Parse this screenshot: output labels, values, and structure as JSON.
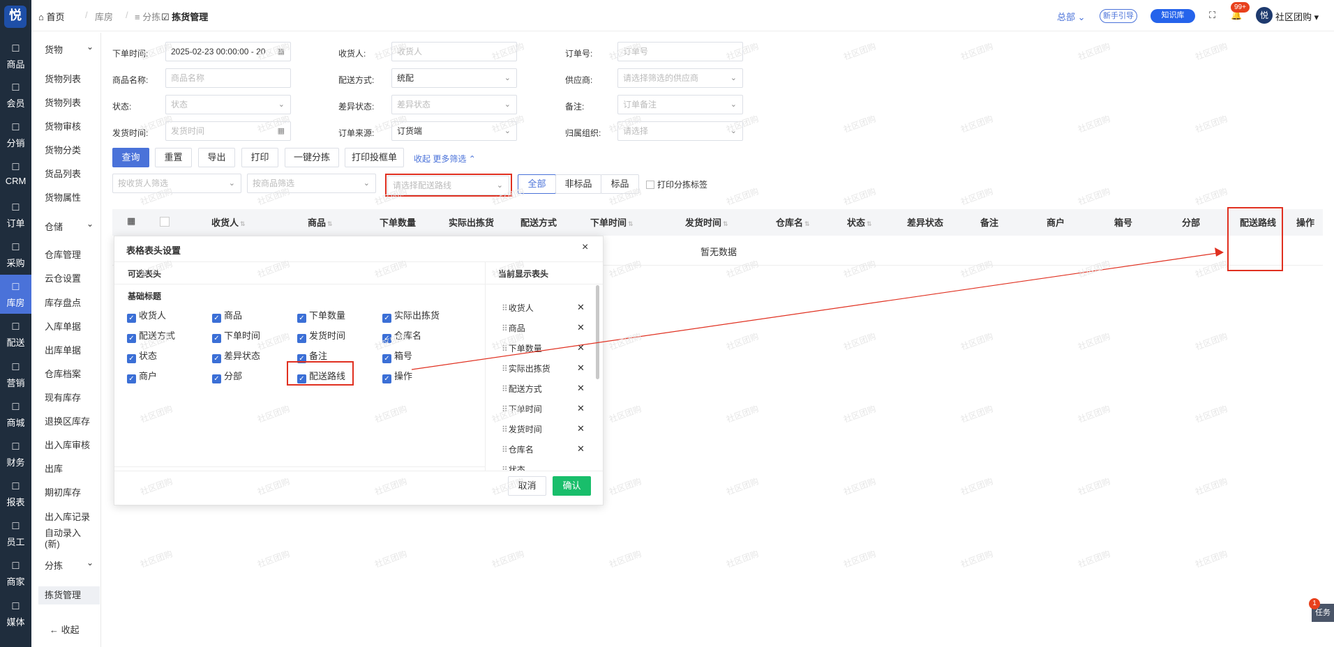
{
  "rail": {
    "logo": "悦",
    "items": [
      {
        "icon": "bag-icon",
        "label": "商品"
      },
      {
        "icon": "user-icon",
        "label": "会员"
      },
      {
        "icon": "share-icon",
        "label": "分销"
      },
      {
        "icon": "crm-icon",
        "label": "CRM"
      },
      {
        "icon": "order-icon",
        "label": "订单"
      },
      {
        "icon": "purchase-icon",
        "label": "采购"
      },
      {
        "icon": "warehouse-icon",
        "label": "库房"
      },
      {
        "icon": "delivery-icon",
        "label": "配送"
      },
      {
        "icon": "gift-icon",
        "label": "营销"
      },
      {
        "icon": "shop-icon",
        "label": "商城"
      },
      {
        "icon": "yen-icon",
        "label": "财务"
      },
      {
        "icon": "chart-icon",
        "label": "报表"
      },
      {
        "icon": "staff-icon",
        "label": "员工"
      },
      {
        "icon": "merchant-icon",
        "label": "商家"
      },
      {
        "icon": "play-icon",
        "label": "媒体"
      }
    ]
  },
  "subnav": {
    "groups": [
      {
        "title": "货物",
        "items": [
          "货物列表",
          "货物列表",
          "货物审核",
          "货物分类",
          "货品列表",
          "货物属性"
        ]
      },
      {
        "title": "仓储",
        "items": [
          "仓库管理",
          "云仓设置",
          "库存盘点",
          "入库单据",
          "出库单据",
          "仓库档案",
          "现有库存",
          "退换区库存",
          "出入库审核",
          "出库",
          "期初库存",
          "出入库记录",
          "自动录入(新)"
        ]
      },
      {
        "title": "分拣",
        "items": [
          "拣货管理"
        ]
      }
    ],
    "collapse": "收起"
  },
  "topbar": {
    "home": "首页",
    "crumbs": [
      "库房",
      "分拣"
    ],
    "current": "拣货管理",
    "branch": "总部",
    "guide": "新手引导",
    "knowledge": "知识库",
    "badge": "99+",
    "org": "社区团购",
    "task_badge": "1",
    "task": "任务"
  },
  "filters": {
    "order_time_label": "下单时间:",
    "order_time_value": "2025-02-23 00:00:00 - 20",
    "receiver_label": "收货人:",
    "receiver_ph": "收货人",
    "order_no_label": "订单号:",
    "order_no_ph": "订单号",
    "goods_name_label": "商品名称:",
    "goods_name_ph": "商品名称",
    "delivery_label": "配送方式:",
    "delivery_value": "统配",
    "supplier_label": "供应商:",
    "supplier_ph": "请选择筛选的供应商",
    "status_label": "状态:",
    "status_ph": "状态",
    "diff_label": "差异状态:",
    "diff_ph": "差异状态",
    "remark_label": "备注:",
    "remark_ph": "订单备注",
    "ship_label": "发货时间:",
    "ship_ph": "发货时间",
    "source_label": "订单来源:",
    "source_value": "订货端",
    "org_label": "归属组织:",
    "org_ph": "请选择"
  },
  "actions": {
    "query": "查询",
    "reset": "重置",
    "export": "导出",
    "print": "打印",
    "one_click": "一键分拣",
    "print_box": "打印投框单",
    "collapse": "收起",
    "more": "更多筛选"
  },
  "filters2": {
    "by_receiver": "按收货人筛选",
    "by_goods": "按商品筛选",
    "route": "请选择配送路线",
    "seg": [
      "全部",
      "非标品",
      "标品"
    ],
    "print_label": "打印分拣标签"
  },
  "table": {
    "headers": [
      "收货人",
      "商品",
      "下单数量",
      "实际出拣货",
      "配送方式",
      "下单时间",
      "发货时间",
      "仓库名",
      "状态",
      "差异状态",
      "备注",
      "商户",
      "箱号",
      "分部",
      "配送路线",
      "操作"
    ],
    "empty": "暂无数据"
  },
  "modal": {
    "title": "表格表头设置",
    "left_title": "可选表头",
    "right_title": "当前显示表头",
    "group": "基础标题",
    "options": [
      "收货人",
      "商品",
      "下单数量",
      "实际出拣货",
      "配送方式",
      "下单时间",
      "发货时间",
      "仓库名",
      "状态",
      "差异状态",
      "备注",
      "箱号",
      "商户",
      "分部",
      "配送路线",
      "操作"
    ],
    "shown": [
      "收货人",
      "商品",
      "下单数量",
      "实际出拣货",
      "配送方式",
      "下单时间",
      "发货时间",
      "仓库名",
      "状态"
    ],
    "cancel": "取消",
    "confirm": "确认"
  },
  "watermark": "社区团购"
}
